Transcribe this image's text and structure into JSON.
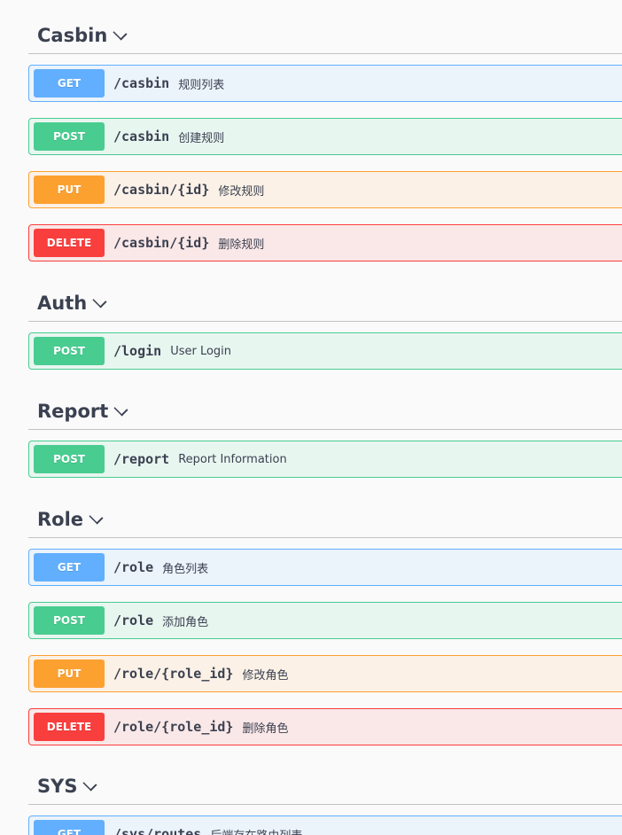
{
  "colors": {
    "get": "#61affe",
    "post": "#49cc90",
    "put": "#fca130",
    "delete": "#f93e3e",
    "text": "#3b4151",
    "background": "#fafafa"
  },
  "sections": [
    {
      "name": "Casbin",
      "operations": [
        {
          "method": "GET",
          "path": "/casbin",
          "summary": "规则列表"
        },
        {
          "method": "POST",
          "path": "/casbin",
          "summary": "创建规则"
        },
        {
          "method": "PUT",
          "path": "/casbin/{id}",
          "summary": "修改规则"
        },
        {
          "method": "DELETE",
          "path": "/casbin/{id}",
          "summary": "删除规则"
        }
      ]
    },
    {
      "name": "Auth",
      "operations": [
        {
          "method": "POST",
          "path": "/login",
          "summary": "User Login"
        }
      ]
    },
    {
      "name": "Report",
      "operations": [
        {
          "method": "POST",
          "path": "/report",
          "summary": "Report Information"
        }
      ]
    },
    {
      "name": "Role",
      "operations": [
        {
          "method": "GET",
          "path": "/role",
          "summary": "角色列表"
        },
        {
          "method": "POST",
          "path": "/role",
          "summary": "添加角色"
        },
        {
          "method": "PUT",
          "path": "/role/{role_id}",
          "summary": "修改角色"
        },
        {
          "method": "DELETE",
          "path": "/role/{role_id}",
          "summary": "删除角色"
        }
      ]
    },
    {
      "name": "SYS",
      "operations": [
        {
          "method": "GET",
          "path": "/sys/routes",
          "summary": "后端存在路由列表"
        }
      ]
    }
  ]
}
